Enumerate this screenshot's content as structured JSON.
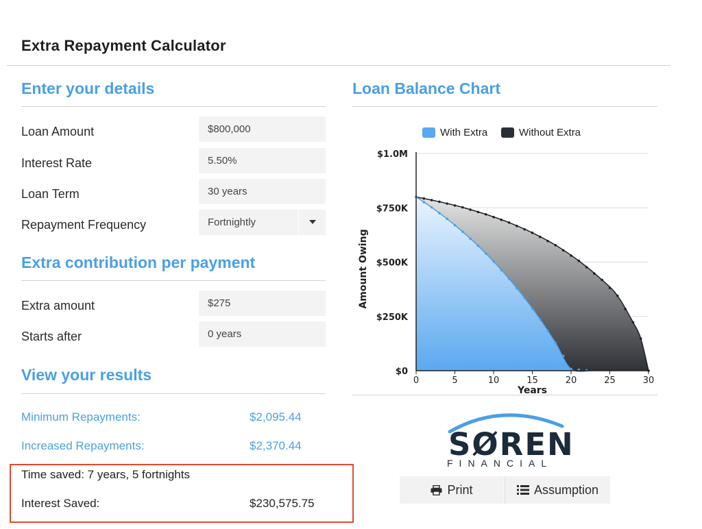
{
  "page": {
    "title": "Extra Repayment Calculator"
  },
  "details": {
    "heading": "Enter your details",
    "loan_amount": {
      "label": "Loan Amount",
      "value": "$800,000"
    },
    "interest_rate": {
      "label": "Interest Rate",
      "value": "5.50%"
    },
    "loan_term": {
      "label": "Loan Term",
      "value": "30 years"
    },
    "repayment_frequency": {
      "label": "Repayment Frequency",
      "value": "Fortnightly"
    }
  },
  "extra": {
    "heading": "Extra contribution per payment",
    "amount": {
      "label": "Extra amount",
      "value": "$275"
    },
    "starts_after": {
      "label": "Starts after",
      "value": "0 years"
    }
  },
  "results": {
    "heading": "View your results",
    "minimum": {
      "label": "Minimum Repayments:",
      "value": "$2,095.44"
    },
    "increased": {
      "label": "Increased Repayments:",
      "value": "$2,370.44"
    },
    "time_saved": "Time saved: 7 years, 5 fortnights",
    "interest_saved": {
      "label": "Interest Saved:",
      "value": "$230,575.75"
    }
  },
  "chart_heading": "Loan Balance Chart",
  "colors": {
    "accent": "#4a9fe6",
    "with_extra": "#5aa8ef",
    "without_extra": "#2a2f36",
    "highlight": "#e0492e"
  },
  "chart_data": {
    "type": "area",
    "title": "",
    "xlabel": "Years",
    "ylabel": "Amount Owing",
    "xlim": [
      0,
      30
    ],
    "ylim": [
      0,
      1000000
    ],
    "x_ticks": [
      "0",
      "5",
      "10",
      "15",
      "20",
      "25",
      "30"
    ],
    "y_ticks": [
      "$0",
      "$250K",
      "$500K",
      "$750K",
      "$1.0M"
    ],
    "legend_position": "top",
    "series": [
      {
        "name": "With Extra",
        "color": "#5aa8ef",
        "points": [
          [
            0,
            800000
          ],
          [
            2,
            752000
          ],
          [
            4,
            699000
          ],
          [
            6,
            640000
          ],
          [
            8,
            575000
          ],
          [
            10,
            503000
          ],
          [
            12,
            423000
          ],
          [
            14,
            335000
          ],
          [
            16,
            237000
          ],
          [
            18,
            128000
          ],
          [
            20,
            8000
          ],
          [
            22.6,
            0
          ]
        ]
      },
      {
        "name": "Without Extra",
        "color": "#2a2f36",
        "points": [
          [
            0,
            800000
          ],
          [
            3,
            778000
          ],
          [
            6,
            752000
          ],
          [
            9,
            720000
          ],
          [
            12,
            682000
          ],
          [
            15,
            635000
          ],
          [
            18,
            578000
          ],
          [
            21,
            506000
          ],
          [
            24,
            418000
          ],
          [
            26,
            345000
          ],
          [
            28,
            223000
          ],
          [
            29,
            148000
          ],
          [
            30,
            0
          ]
        ]
      }
    ]
  },
  "logo": {
    "name": "SØREN",
    "subtitle": "FINANCIAL"
  },
  "actions": {
    "print_label": "Print",
    "print_icon": "printer-icon",
    "assumption_label": "Assumption",
    "assumption_icon": "list-icon"
  }
}
